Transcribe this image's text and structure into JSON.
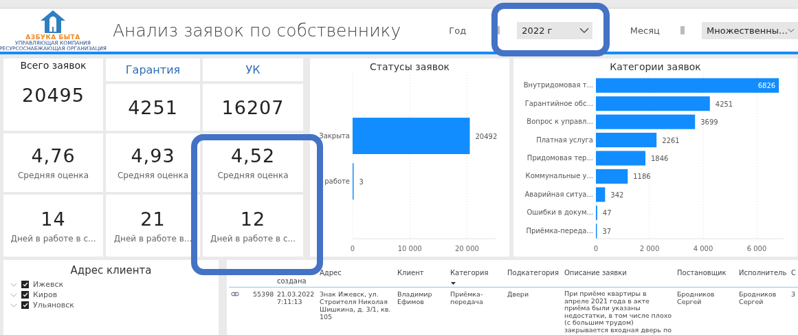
{
  "header": {
    "logo": {
      "name": "АЗБУКА БЫТА",
      "lines": [
        "УПРАВЛЯЮЩАЯ КОМПАНИЯ",
        "РЕСУРСОСНАБЖАЮЩАЯ ОРГАНИЗАЦИЯ"
      ]
    },
    "title": "Анализ заявок по собственнику",
    "filters": [
      {
        "label": "Год",
        "value": "2022 г"
      },
      {
        "label": "Месяц",
        "value": "Множественны…"
      }
    ]
  },
  "kpi": {
    "total": {
      "title": "Всего заявок",
      "value": "20495",
      "rating": "4,76",
      "rating_label": "Средняя оценка",
      "days": "14",
      "days_label": "Дней в работе в с..."
    },
    "groups": [
      {
        "title": "Гарантия",
        "value": "4251",
        "rating": "4,93",
        "rating_label": "Средняя оценка",
        "days": "21",
        "days_label": "Дней в работе в..."
      },
      {
        "title": "УК",
        "value": "16207",
        "rating": "4,52",
        "rating_label": "Средняя оценка",
        "days": "12",
        "days_label": "Дней в работе в с..."
      }
    ]
  },
  "status_chart": {
    "chart_data": {
      "type": "bar",
      "orientation": "horizontal",
      "title": "Статусы заявок",
      "categories": [
        "Закрыта",
        "работе"
      ],
      "values": [
        20492,
        3
      ],
      "xticks": [
        {
          "value": 0,
          "label": "0"
        },
        {
          "value": 10000,
          "label": "10 000"
        },
        {
          "value": 20000,
          "label": "20 000"
        }
      ],
      "xlim": [
        0,
        25000
      ],
      "grid": true,
      "data_labels": true
    }
  },
  "category_chart": {
    "chart_data": {
      "type": "bar",
      "orientation": "horizontal",
      "title": "Категории заявок",
      "categories": [
        "Внутридомовая т...",
        "Гарантийное обс...",
        "Вопрос к управл...",
        "Платная услуга",
        "Придомовая тер...",
        "Коммунальные у...",
        "Аварийная ситуа...",
        "Ошибки в докум...",
        "Приёмка-переда..."
      ],
      "values": [
        6826,
        4251,
        3699,
        2261,
        1846,
        1186,
        342,
        47,
        37
      ],
      "xticks": [
        {
          "value": 0,
          "label": "0"
        },
        {
          "value": 2000,
          "label": "2 000"
        },
        {
          "value": 4000,
          "label": "4 000"
        },
        {
          "value": 6000,
          "label": "6 000"
        }
      ],
      "xlim": [
        0,
        7000
      ],
      "grid": true,
      "data_labels": true
    }
  },
  "address_filter": {
    "title": "Адрес клиента",
    "items": [
      {
        "label": "Ижевск",
        "checked": true,
        "expanded": false
      },
      {
        "label": "Киров",
        "checked": true,
        "expanded": false
      },
      {
        "label": "Ульяновск",
        "checked": true,
        "expanded": false
      }
    ]
  },
  "table": {
    "columns": [
      {
        "sorted": false
      },
      {
        "label": "создана",
        "sorted": false
      },
      {
        "label": "Адрес",
        "sorted": false
      },
      {
        "label": "Клиент",
        "sorted": false
      },
      {
        "label": "Категория",
        "sorted": true
      },
      {
        "label": "Подкатегория",
        "sorted": false
      },
      {
        "label": "Описание заявки",
        "sorted": false
      },
      {
        "label": "Постановщик",
        "sorted": false
      },
      {
        "label": "Исполнитель",
        "sorted": false
      },
      {
        "label": "С",
        "sorted": false
      }
    ],
    "rows": [
      {
        "cells": [
          "55398",
          "21.03.2022 7:11:13",
          "Знак Ижевск, ул. Строителя Николая Шишкина, д. 3/1, кв. 105",
          "Владимир Ефимов",
          "Приёмка-передача",
          "Двери",
          "При приёме квартиры в апреле 2021 года в акте приёма были указаны недостатки, в том числе плохо (с большим трудом) закрывается входная дверь по",
          "Бродников Сергей",
          "Бродников Сергей",
          "3"
        ]
      }
    ]
  }
}
